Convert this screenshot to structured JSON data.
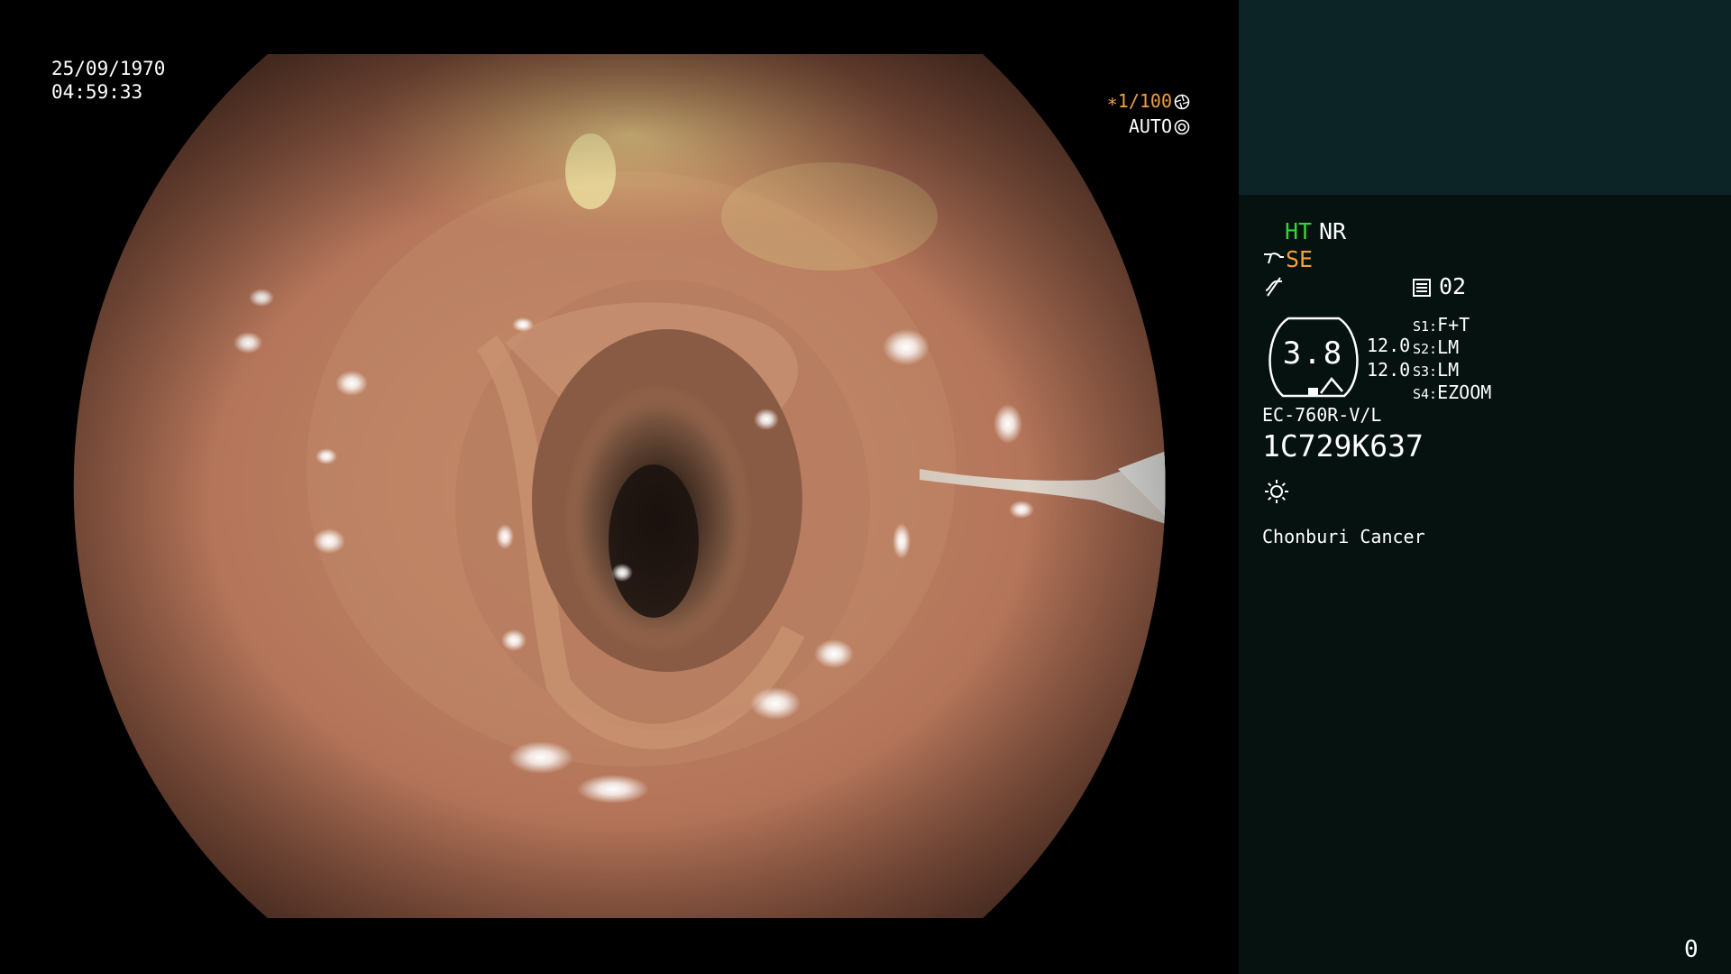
{
  "overlay": {
    "date": "25/09/1970",
    "time": "04:59:33",
    "shutter": "∗1/100",
    "iris": "AUTO"
  },
  "panel": {
    "ht": "HT",
    "nr": "NR",
    "se": "SE",
    "memory": "02",
    "zoom": "3.8",
    "sub_values": [
      "12.0",
      "12.0"
    ],
    "slots": [
      {
        "key": "S1:",
        "value": "F+T"
      },
      {
        "key": "S2:",
        "value": "LM"
      },
      {
        "key": "S3:",
        "value": "LM"
      },
      {
        "key": "S4:",
        "value": "EZOOM"
      }
    ],
    "scope_model": "EC-760R-V/L",
    "scope_serial": "1C729K637",
    "hospital": "Chonburi Cancer",
    "counter": "0"
  },
  "colors": {
    "ht": "#33d633",
    "se": "#f0a040",
    "shutter": "#f0a040",
    "panel_top": "#0d2427",
    "panel_bottom": "#051210"
  },
  "icons": [
    "shutter-icon",
    "iris-icon",
    "enhancement-icon",
    "curve-icon",
    "memory-icon",
    "zoom-gauge-icon",
    "brightness-icon"
  ]
}
